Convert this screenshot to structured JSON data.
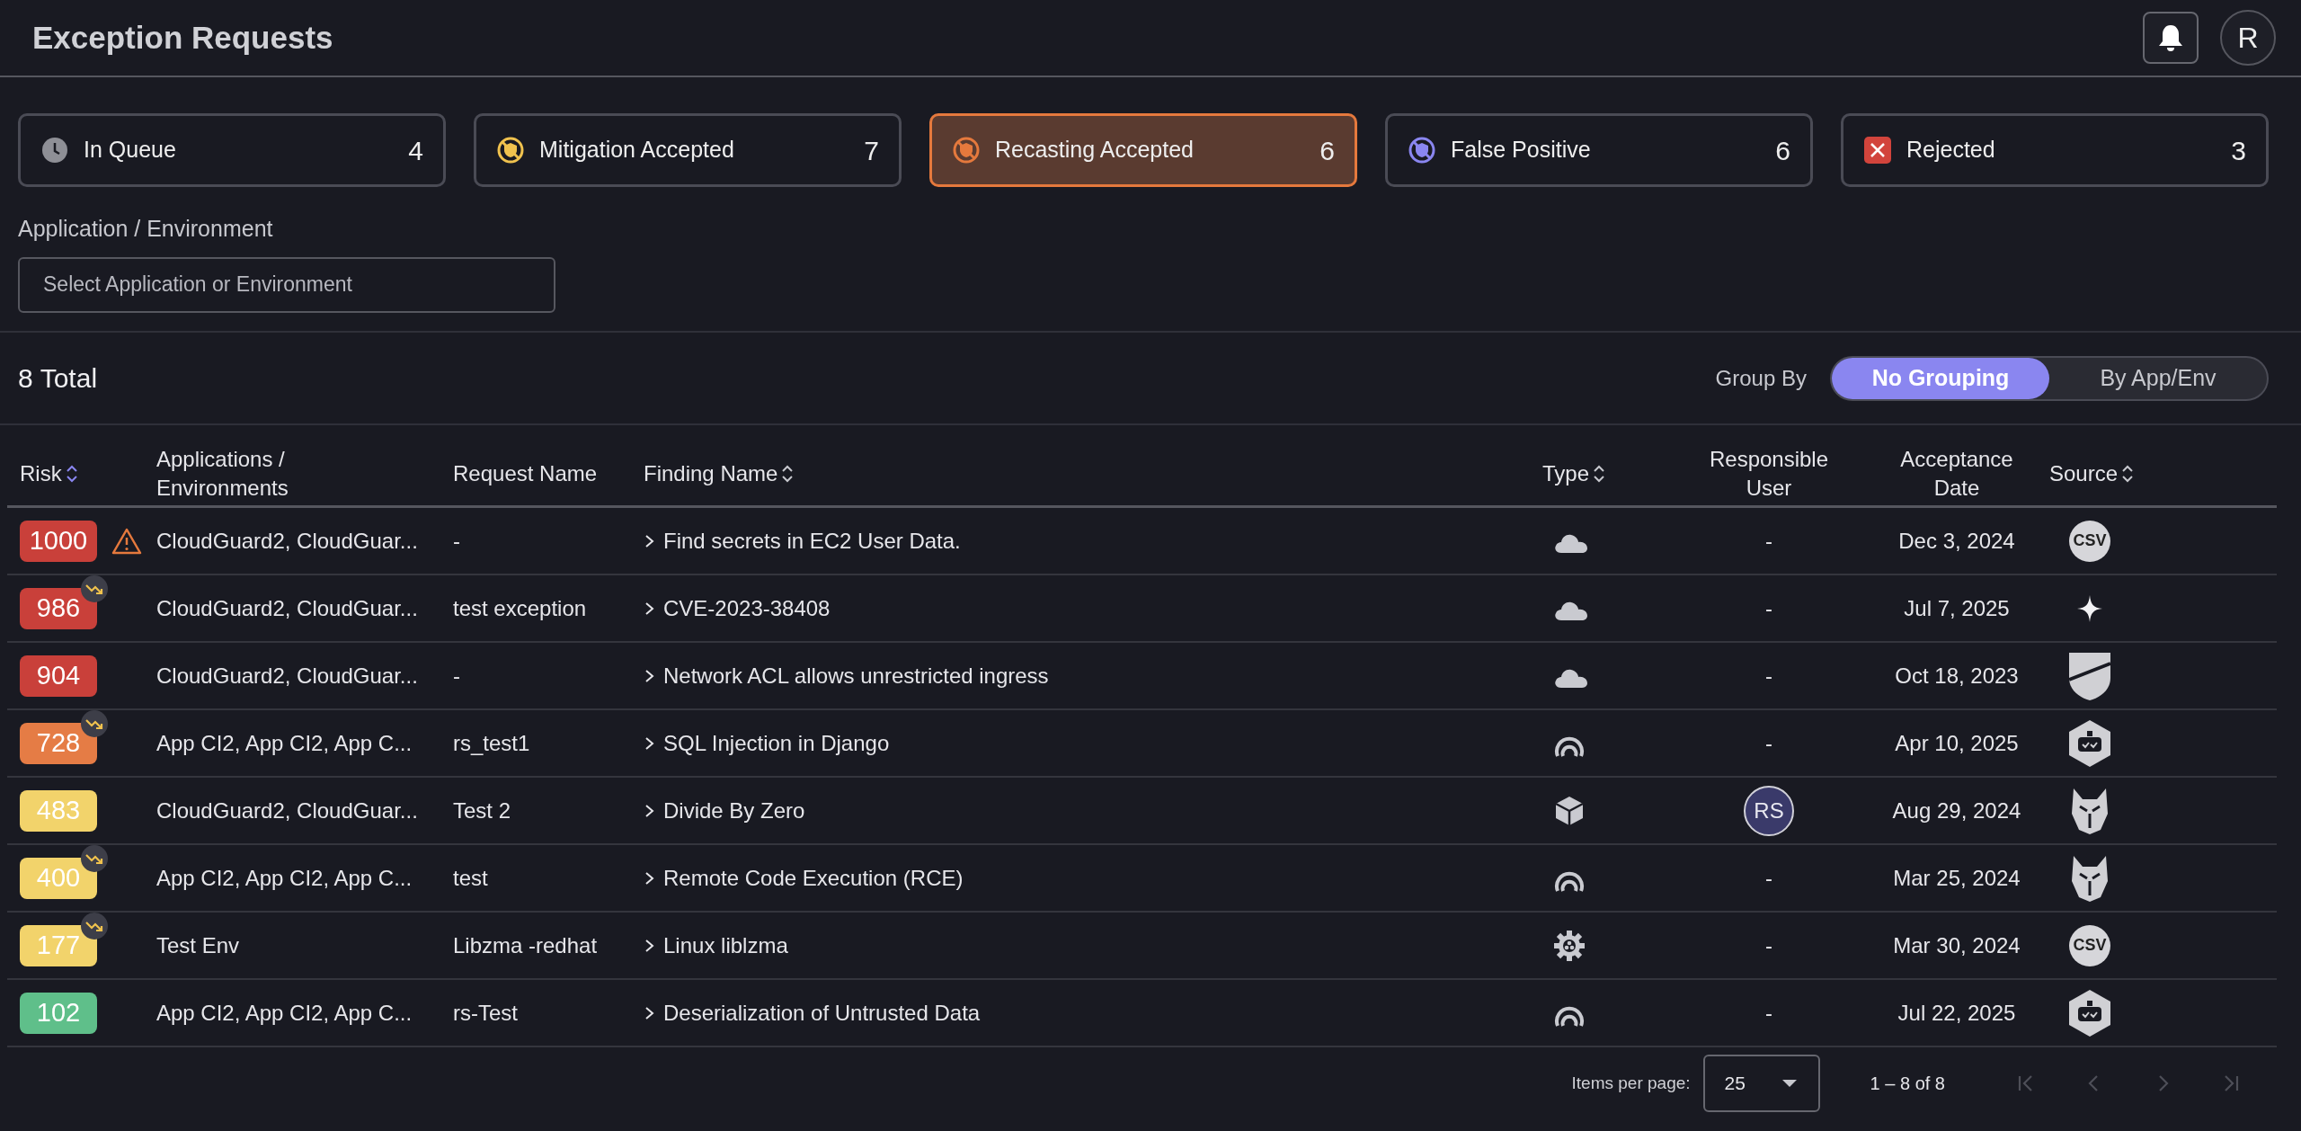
{
  "header": {
    "title": "Exception Requests",
    "avatar": "R"
  },
  "status_cards": [
    {
      "label": "In Queue",
      "count": "4",
      "kind": "queue",
      "selected": false
    },
    {
      "label": "Mitigation Accepted",
      "count": "7",
      "kind": "mitigation",
      "selected": false
    },
    {
      "label": "Recasting Accepted",
      "count": "6",
      "kind": "recasting",
      "selected": true
    },
    {
      "label": "False Positive",
      "count": "6",
      "kind": "false_positive",
      "selected": false
    },
    {
      "label": "Rejected",
      "count": "3",
      "kind": "rejected",
      "selected": false
    }
  ],
  "filter": {
    "label": "Application / Environment",
    "placeholder": "Select Application or Environment"
  },
  "summary": {
    "count": "8",
    "label": "Total"
  },
  "group_by": {
    "label": "Group By",
    "options": [
      {
        "label": "No Grouping",
        "selected": true
      },
      {
        "label": "By App/Env",
        "selected": false
      }
    ]
  },
  "table": {
    "columns": [
      {
        "label": "Risk",
        "sortable": true,
        "sorted": true
      },
      {
        "label": "Applications / Environments",
        "sortable": false
      },
      {
        "label": "Request Name",
        "sortable": false
      },
      {
        "label": "Finding Name",
        "sortable": true,
        "sorted": false
      },
      {
        "label": "Type",
        "sortable": true,
        "sorted": false
      },
      {
        "label": "Responsible User",
        "sortable": false
      },
      {
        "label": "Acceptance Date",
        "sortable": false
      },
      {
        "label": "Source",
        "sortable": true,
        "sorted": false
      }
    ],
    "rows": [
      {
        "risk": "1000",
        "color": "#c9403a",
        "alert": true,
        "trend": false,
        "applications": "CloudGuard2, CloudGuar...",
        "request_name": "-",
        "expanded": false,
        "finding_name": "Find secrets in EC2 User Data.",
        "type": {
          "kind": "cloud"
        },
        "user": {
          "kind": "text",
          "value": "-"
        },
        "acceptance_date": "Dec 3, 2024",
        "source": {
          "kind": "csv",
          "label": "CSV"
        }
      },
      {
        "risk": "986",
        "color": "#c9403a",
        "alert": false,
        "trend": true,
        "applications": "CloudGuard2, CloudGuar...",
        "request_name": "test exception",
        "expanded": false,
        "finding_name": "CVE-2023-38408",
        "type": {
          "kind": "cloud"
        },
        "user": {
          "kind": "text",
          "value": "-"
        },
        "acceptance_date": "Jul 7, 2025",
        "source": {
          "kind": "sparkle"
        }
      },
      {
        "risk": "904",
        "color": "#c9403a",
        "alert": false,
        "trend": false,
        "applications": "CloudGuard2, CloudGuar...",
        "request_name": "-",
        "expanded": false,
        "finding_name": "Network ACL allows unrestricted ingress",
        "type": {
          "kind": "cloud"
        },
        "user": {
          "kind": "text",
          "value": "-"
        },
        "acceptance_date": "Oct 18, 2023",
        "source": {
          "kind": "shield"
        }
      },
      {
        "risk": "728",
        "color": "#e57c45",
        "alert": false,
        "trend": true,
        "applications": "App CI2, App CI2, App C...",
        "request_name": "rs_test1",
        "expanded": false,
        "finding_name": "SQL Injection in Django",
        "type": {
          "kind": "radar"
        },
        "user": {
          "kind": "text",
          "value": "-"
        },
        "acceptance_date": "Apr 10, 2025",
        "source": {
          "kind": "robot"
        }
      },
      {
        "risk": "483",
        "color": "#f2d36b",
        "alert": false,
        "trend": false,
        "applications": "CloudGuard2, CloudGuar...",
        "request_name": "Test 2",
        "expanded": false,
        "finding_name": "Divide By Zero",
        "type": {
          "kind": "cube"
        },
        "user": {
          "kind": "avatar",
          "value": "RS"
        },
        "acceptance_date": "Aug 29, 2024",
        "source": {
          "kind": "mask"
        }
      },
      {
        "risk": "400",
        "color": "#f2d36b",
        "alert": false,
        "trend": true,
        "applications": "App CI2, App CI2, App C...",
        "request_name": "test",
        "expanded": false,
        "finding_name": "Remote Code Execution (RCE)",
        "type": {
          "kind": "radar"
        },
        "user": {
          "kind": "text",
          "value": "-"
        },
        "acceptance_date": "Mar 25, 2024",
        "source": {
          "kind": "mask"
        }
      },
      {
        "risk": "177",
        "color": "#f2d36b",
        "alert": false,
        "trend": true,
        "applications": "Test Env",
        "request_name": "Libzma -redhat",
        "expanded": false,
        "finding_name": "Linux liblzma",
        "type": {
          "kind": "gear"
        },
        "user": {
          "kind": "text",
          "value": "-"
        },
        "acceptance_date": "Mar 30, 2024",
        "source": {
          "kind": "csv",
          "label": "CSV"
        }
      },
      {
        "risk": "102",
        "color": "#5fbf8a",
        "alert": false,
        "trend": false,
        "applications": "App CI2, App CI2, App C...",
        "request_name": "rs-Test",
        "expanded": false,
        "finding_name": "Deserialization of Untrusted Data",
        "type": {
          "kind": "radar"
        },
        "user": {
          "kind": "text",
          "value": "-"
        },
        "acceptance_date": "Jul 22, 2025",
        "source": {
          "kind": "robot"
        }
      }
    ]
  },
  "pagination": {
    "items_per_page_label": "Items per page:",
    "items_per_page": "25",
    "range": "1 – 8 of 8",
    "buttons": [
      {
        "kind": "first",
        "disabled": true
      },
      {
        "kind": "prev",
        "disabled": true
      },
      {
        "kind": "next",
        "disabled": true
      },
      {
        "kind": "last",
        "disabled": true
      }
    ]
  }
}
